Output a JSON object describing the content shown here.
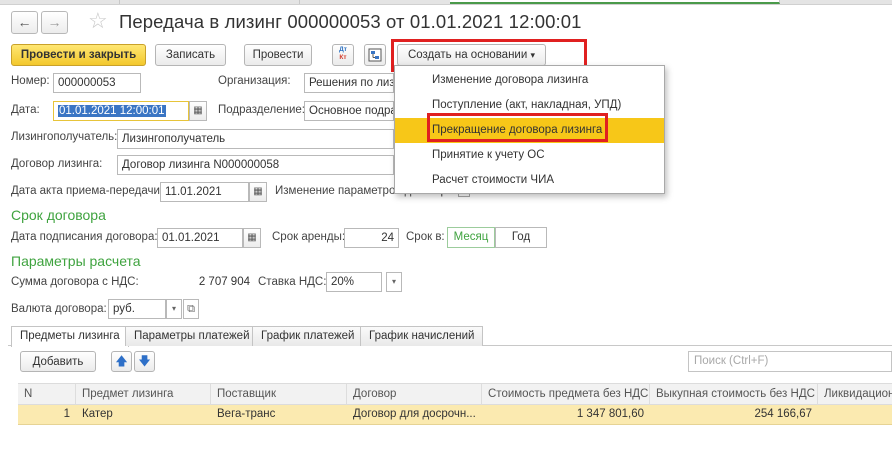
{
  "header": {
    "back_glyph": "←",
    "forward_glyph": "→",
    "favorite_glyph": "☆",
    "title": "Передача в лизинг 000000053 от 01.01.2021 12:00:01"
  },
  "toolbar": {
    "post_close": "Провести и закрыть",
    "save": "Записать",
    "post": "Провести",
    "dtkt_top": "Дт",
    "dtkt_bottom": "Кт",
    "create_based": "Создать на основании",
    "dropdown_arrow": "▾"
  },
  "create_menu": {
    "items": [
      "Изменение договора лизинга",
      "Поступление (акт, накладная, УПД)",
      "Прекращение договора лизинга",
      "Принятие к учету ОС",
      "Расчет стоимости ЧИА"
    ],
    "highlighted_index": 2
  },
  "form": {
    "number_label": "Номер:",
    "number": "000000053",
    "org_label": "Организация:",
    "org": "Решения по лизи",
    "date_label": "Дата:",
    "date": "01.01.2021 12:00:01",
    "division_label": "Подразделение:",
    "division": "Основное подраз",
    "lessee_label": "Лизингополучатель:",
    "lessee": "Лизингополучатель",
    "contract_label": "Договор лизинга:",
    "contract": "Договор лизинга N000000058",
    "act_date_label": "Дата акта приема-передачи:",
    "act_date": "11.01.2021",
    "change_params_label": "Изменение параметров договора:",
    "calendar_glyph": "▦"
  },
  "term": {
    "section": "Срок договора",
    "sign_date_label": "Дата подписания договора:",
    "sign_date": "01.01.2021",
    "term_label": "Срок аренды:",
    "term_value": "24",
    "unit_label": "Срок в:",
    "unit_month": "Месяц",
    "unit_year": "Год"
  },
  "calc": {
    "section": "Параметры расчета",
    "sum_label": "Сумма договора с НДС:",
    "sum": "2 707 904",
    "vat_label": "Ставка НДС:",
    "vat": "20%",
    "currency_label": "Валюта договора:",
    "currency": "руб.",
    "open_glyph": "⧉"
  },
  "tabs": [
    "Предметы лизинга",
    "Параметры платежей",
    "График платежей",
    "График начислений"
  ],
  "table_toolbar": {
    "add": "Добавить",
    "up": "🡅",
    "down": "🡇",
    "search_placeholder": "Поиск (Ctrl+F)"
  },
  "table": {
    "columns": [
      "N",
      "Предмет лизинга",
      "Поставщик",
      "Договор",
      "Стоимость предмета без НДС",
      "Выкупная стоимость без НДС",
      "Ликвидацион"
    ],
    "rows": [
      [
        "1",
        "Катер",
        "Вега-транс",
        "Договор для досрочн...",
        "1 347 801,60",
        "254 166,67",
        ""
      ]
    ]
  },
  "colors": {
    "accent_green": "#3fa33f",
    "primary_yellow": "#f3c82c",
    "menu_highlight": "#f7c718",
    "annotation_red": "#e02020",
    "selected_row": "#fbeab0"
  }
}
